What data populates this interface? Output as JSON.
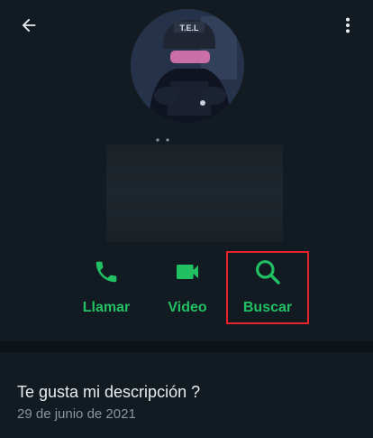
{
  "colors": {
    "background": "#121b22",
    "accent": "#21c063",
    "highlight_border": "#e8222a",
    "primary_text": "#e9edef",
    "secondary_text": "#8696a0"
  },
  "header": {
    "back_icon": "arrow-left-icon",
    "menu_icon": "more-vertical-icon"
  },
  "avatar": {
    "badge_text": "T.E.L"
  },
  "actions": [
    {
      "label": "Llamar",
      "icon": "phone-icon"
    },
    {
      "label": "Video",
      "icon": "video-camera-icon"
    },
    {
      "label": "Buscar",
      "icon": "search-icon",
      "highlighted": true
    }
  ],
  "about": {
    "text": "Te gusta mi descripción ?",
    "date": "29 de junio de 2021"
  }
}
